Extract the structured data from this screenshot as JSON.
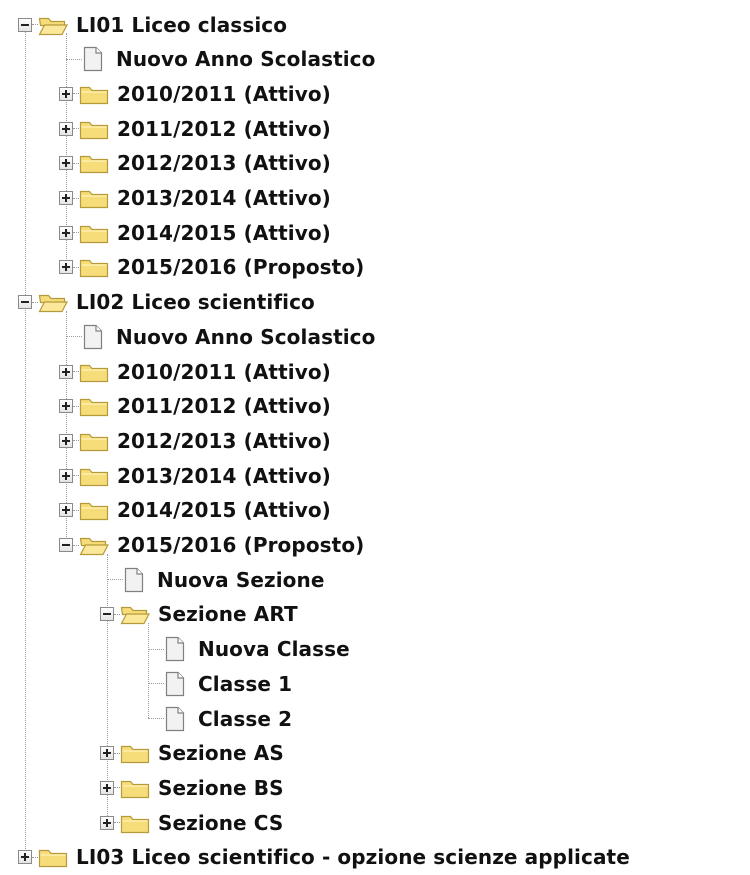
{
  "tree": [
    {
      "label": "LI01 Liceo classico",
      "type": "folder",
      "expanded": true,
      "children": [
        {
          "label": "Nuovo Anno Scolastico",
          "type": "file"
        },
        {
          "label": "2010/2011 (Attivo)",
          "type": "folder",
          "expanded": false
        },
        {
          "label": "2011/2012 (Attivo)",
          "type": "folder",
          "expanded": false
        },
        {
          "label": "2012/2013 (Attivo)",
          "type": "folder",
          "expanded": false
        },
        {
          "label": "2013/2014 (Attivo)",
          "type": "folder",
          "expanded": false
        },
        {
          "label": "2014/2015 (Attivo)",
          "type": "folder",
          "expanded": false
        },
        {
          "label": "2015/2016 (Proposto)",
          "type": "folder",
          "expanded": false
        }
      ]
    },
    {
      "label": "LI02 Liceo scientifico",
      "type": "folder",
      "expanded": true,
      "children": [
        {
          "label": "Nuovo Anno Scolastico",
          "type": "file"
        },
        {
          "label": "2010/2011 (Attivo)",
          "type": "folder",
          "expanded": false
        },
        {
          "label": "2011/2012 (Attivo)",
          "type": "folder",
          "expanded": false
        },
        {
          "label": "2012/2013 (Attivo)",
          "type": "folder",
          "expanded": false
        },
        {
          "label": "2013/2014 (Attivo)",
          "type": "folder",
          "expanded": false
        },
        {
          "label": "2014/2015 (Attivo)",
          "type": "folder",
          "expanded": false
        },
        {
          "label": "2015/2016 (Proposto)",
          "type": "folder",
          "expanded": true,
          "children": [
            {
              "label": "Nuova Sezione",
              "type": "file"
            },
            {
              "label": "Sezione ART",
              "type": "folder",
              "expanded": true,
              "children": [
                {
                  "label": "Nuova Classe",
                  "type": "file"
                },
                {
                  "label": "Classe 1",
                  "type": "file"
                },
                {
                  "label": "Classe 2",
                  "type": "file"
                }
              ]
            },
            {
              "label": "Sezione AS",
              "type": "folder",
              "expanded": false
            },
            {
              "label": "Sezione BS",
              "type": "folder",
              "expanded": false
            },
            {
              "label": "Sezione CS",
              "type": "folder",
              "expanded": false
            }
          ]
        }
      ]
    },
    {
      "label": "LI03 Liceo scientifico - opzione scienze applicate",
      "type": "folder",
      "expanded": false
    }
  ],
  "icons": {
    "folder_closed": "folder-icon",
    "folder_open": "folder-open-icon",
    "file": "document-icon",
    "expand": "plus-box-icon",
    "collapse": "minus-box-icon"
  },
  "colors": {
    "folder_fill": "#F7DC7A",
    "folder_edge": "#B59A3C",
    "document_fill": "#F2F2F2",
    "document_edge": "#808080",
    "tree_line": "#9A9A9A"
  }
}
